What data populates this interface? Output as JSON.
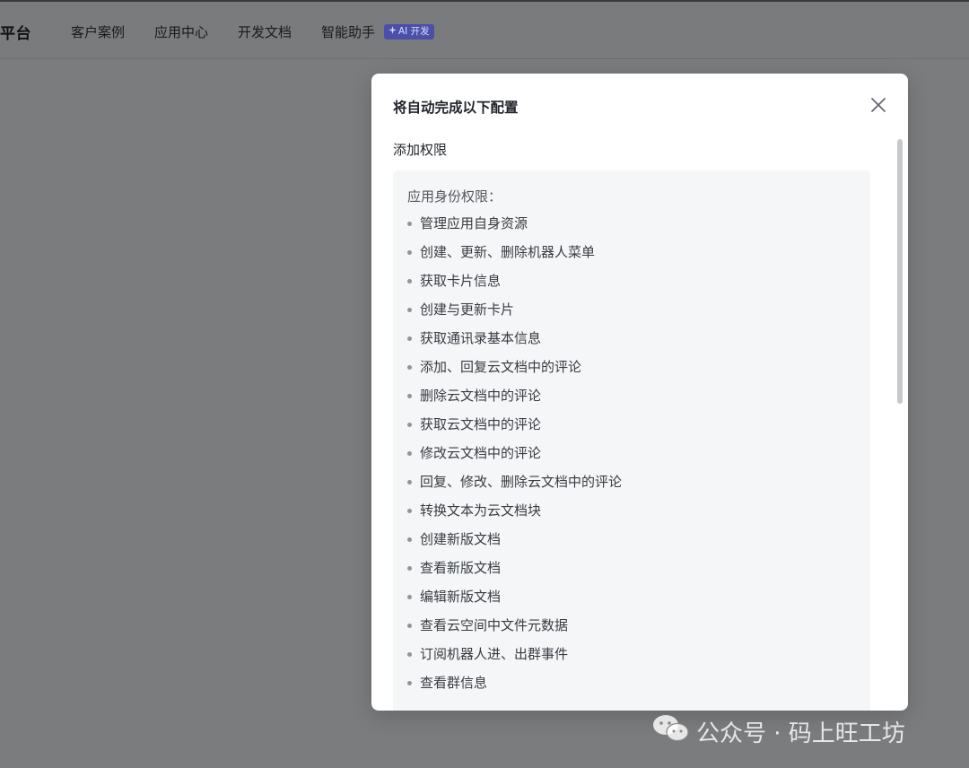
{
  "header": {
    "brand": "平台",
    "nav": [
      "客户案例",
      "应用中心",
      "开发文档",
      "智能助手"
    ],
    "ai_badge": "AI 开发"
  },
  "modal": {
    "title": "将自动完成以下配置",
    "section_title": "添加权限",
    "permissions_heading": "应用身份权限：",
    "permissions": [
      "管理应用自身资源",
      "创建、更新、删除机器人菜单",
      "获取卡片信息",
      "创建与更新卡片",
      "获取通讯录基本信息",
      "添加、回复云文档中的评论",
      "删除云文档中的评论",
      "获取云文档中的评论",
      "修改云文档中的评论",
      "回复、修改、删除云文档中的评论",
      "转换文本为云文档块",
      "创建新版文档",
      "查看新版文档",
      "编辑新版文档",
      "查看云空间中文件元数据",
      "订阅机器人进、出群事件",
      "查看群信息"
    ]
  },
  "watermark": "公众号 · 码上旺工坊",
  "colors": {
    "overlay": "#7b7c7e",
    "ai_badge_bg": "#4b4fa8",
    "modal_bg": "#ffffff",
    "permission_box_bg": "#f5f6f7"
  },
  "icons": {
    "ai_badge": "sparkle-icon",
    "close": "close-icon",
    "watermark": "wechat-icon"
  }
}
